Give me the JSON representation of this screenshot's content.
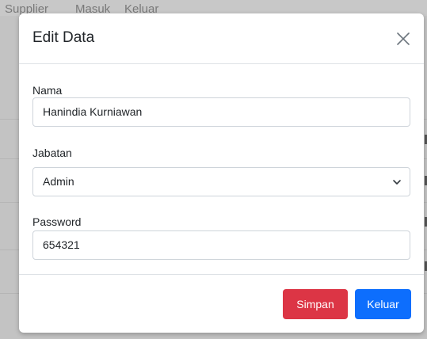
{
  "background": {
    "nav_items": [
      "Supplier",
      "Masuk",
      "Keluar"
    ]
  },
  "modal": {
    "title": "Edit Data",
    "close_icon": "close-icon",
    "fields": {
      "nama": {
        "label": "Nama",
        "value": "Hanindia Kurniawan"
      },
      "jabatan": {
        "label": "Jabatan",
        "value": "Admin",
        "icon": "chevron-down-icon"
      },
      "password": {
        "label": "Password",
        "value": "654321"
      }
    },
    "buttons": {
      "simpan": {
        "label": "Simpan",
        "color": "#dc3545"
      },
      "keluar": {
        "label": "Keluar",
        "color": "#0d6efd"
      }
    }
  }
}
